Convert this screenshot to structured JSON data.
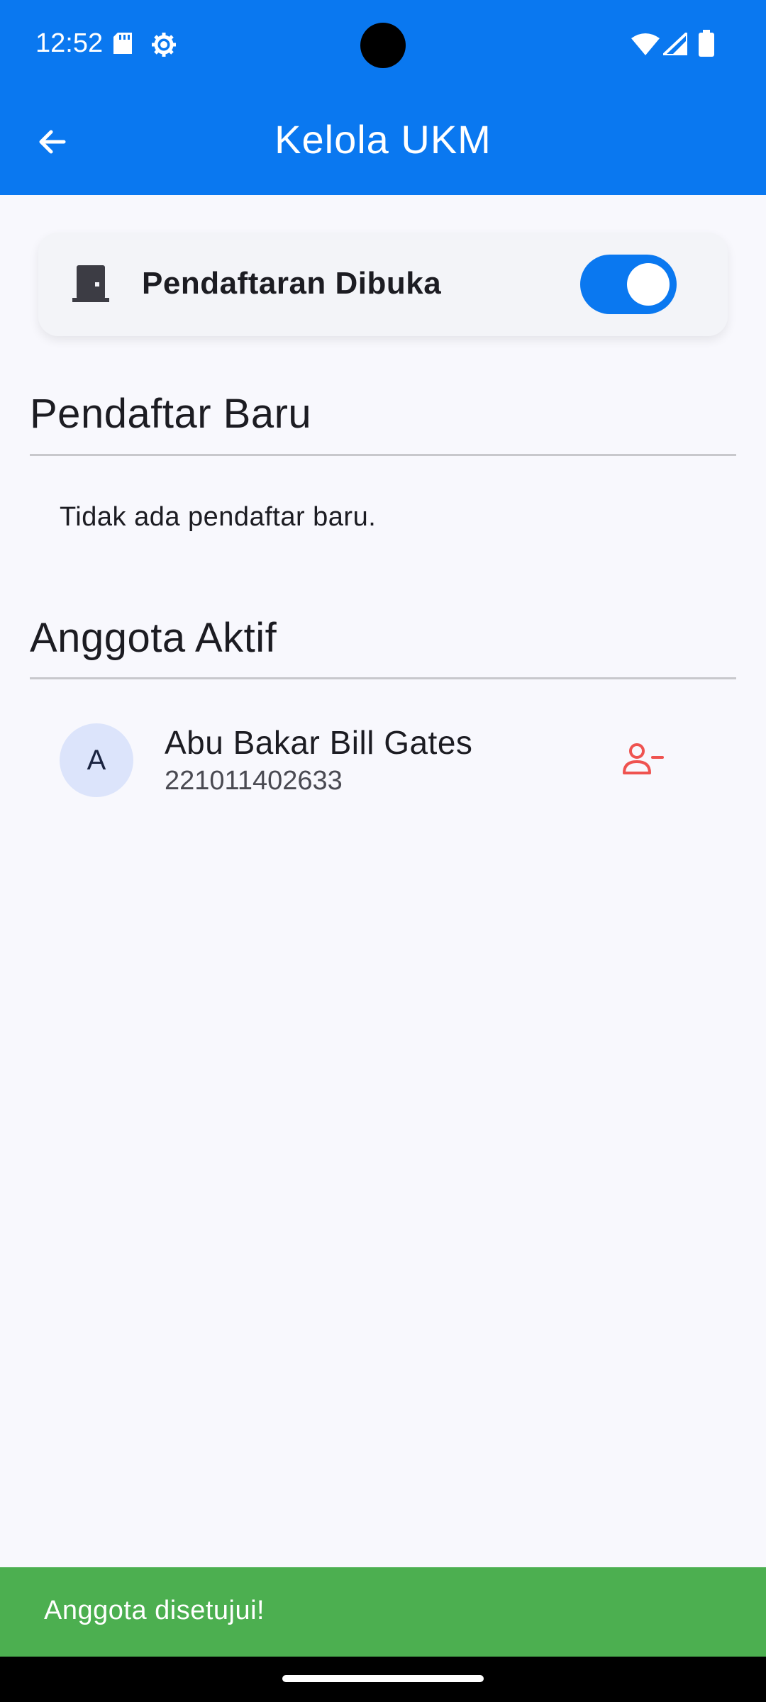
{
  "status_bar": {
    "time": "12:52",
    "icons": [
      "sd-card-icon",
      "gear-icon",
      "wifi-icon",
      "signal-icon",
      "battery-icon"
    ]
  },
  "app_bar": {
    "title": "Kelola UKM",
    "back_icon": "arrow-left-icon"
  },
  "registration": {
    "label": "Pendaftaran Dibuka",
    "icon": "door-icon",
    "toggle_on": true
  },
  "sections": {
    "new_applicants": {
      "title": "Pendaftar Baru",
      "empty_text": "Tidak ada pendaftar baru."
    },
    "active_members": {
      "title": "Anggota Aktif",
      "members": [
        {
          "initial": "A",
          "name": "Abu Bakar Bill Gates",
          "id": "221011402633",
          "action_icon": "remove-user-icon"
        }
      ]
    }
  },
  "snackbar": {
    "message": "Anggota disetujui!"
  },
  "colors": {
    "primary": "#0a78f0",
    "success": "#4caf50",
    "danger": "#ef5350",
    "background": "#f8f8fd"
  }
}
